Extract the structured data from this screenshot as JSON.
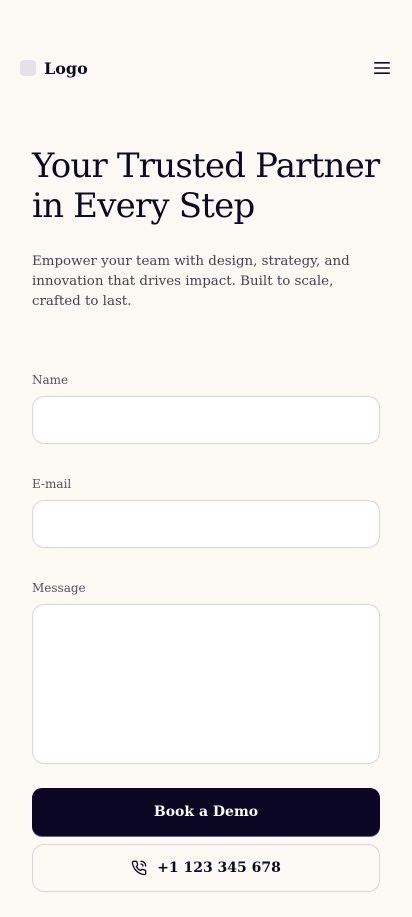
{
  "header": {
    "logo_text": "Logo",
    "menu_icon": "hamburger-menu-icon"
  },
  "hero": {
    "title": "Your Trusted Partner in Every Step",
    "subtitle": "Empower your team with design, strategy, and innovation that drives impact. Built to scale, crafted to last."
  },
  "form": {
    "name_label": "Name",
    "name_value": "",
    "email_label": "E-mail",
    "email_value": "",
    "message_label": "Message",
    "message_value": ""
  },
  "actions": {
    "primary_label": "Book a Demo",
    "phone_label": "+1 123 345 678",
    "phone_icon": "phone-icon"
  },
  "colors": {
    "background": "#fdf9f4",
    "primary": "#0b0624",
    "text": "#0b0a24"
  }
}
